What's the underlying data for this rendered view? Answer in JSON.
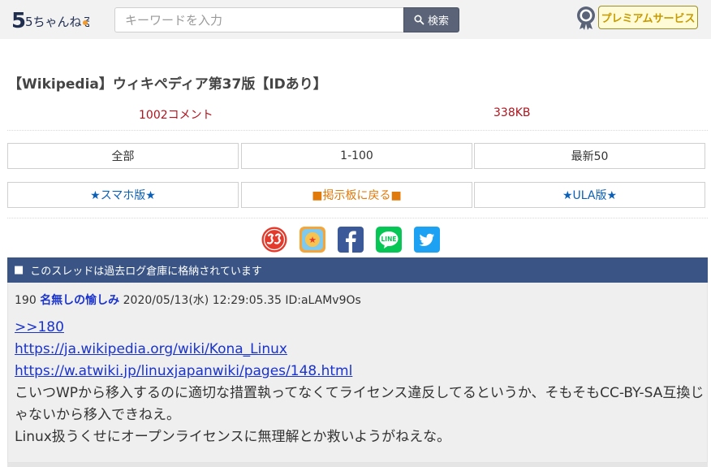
{
  "header": {
    "logo_text": "5ちゃんねる",
    "search": {
      "placeholder": "キーワードを入力",
      "value": ""
    },
    "search_button_label": "検索",
    "premium_label": "プレミアムサービス"
  },
  "thread": {
    "title": "【Wikipedia】ウィキペディア第37版【IDあり】",
    "comment_count": "1002コメント",
    "size": "338KB"
  },
  "nav_buttons": {
    "all": "全部",
    "range": "1-100",
    "latest": "最新50",
    "smartphone": "★スマホ版★",
    "back_to_board": "■掲示板に戻る■",
    "ula": "★ULA版★"
  },
  "share": {
    "icons": [
      "ss-icon",
      "app-icon",
      "facebook-icon",
      "line-icon",
      "twitter-icon"
    ]
  },
  "archive_notice": {
    "marker": "■",
    "text": "このスレッドは過去ログ倉庫に格納されています"
  },
  "post": {
    "number": "190",
    "name": "名無しの愉しみ",
    "datetime": "2020/05/13(水) 12:29:05.35",
    "id": "ID:aLAMv9Os",
    "reply_anchor": ">>180",
    "link1": "https://ja.wikipedia.org/wiki/Kona_Linux",
    "link2": "https://w.atwiki.jp/linuxjapanwiki/pages/148.html",
    "text1": "こいつWPから移入するのに適切な措置執ってなくてライセンス違反してるというか、そもそもCC-BY-SA互換じゃないから移入できねえ。",
    "text2": "Linux扱うくせにオープンライセンスに無理解とか救いようがねえな。"
  },
  "colors": {
    "header_bg": "#f2f2f2",
    "search_button": "#5a6377",
    "archive_bar": "#3a5585",
    "post_bg": "#efefef",
    "link": "#1a33cc",
    "meta_red": "#b0141e",
    "premium_gold": "#c79a00"
  }
}
